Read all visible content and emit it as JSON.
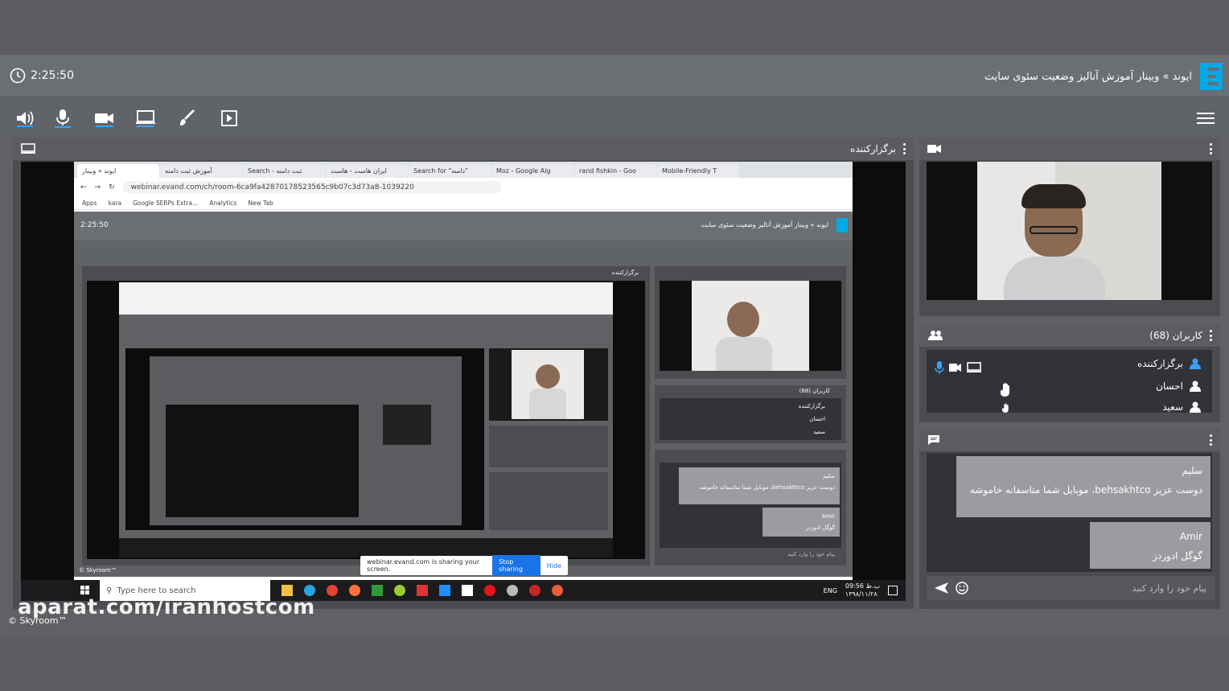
{
  "header": {
    "time": "2:25:50",
    "title": "ایوند » وبینار آموزش آنالیز وضعیت سئوی سایت"
  },
  "toolbar": {
    "icons": [
      "speaker-icon",
      "microphone-icon",
      "camera-icon",
      "screen-share-icon",
      "brush-icon",
      "play-file-icon"
    ]
  },
  "presenter_panel": {
    "title": "برگزارکننده"
  },
  "shared_screen": {
    "tabs": [
      "ایوند » وبینار",
      "آموزش ثبت دامنه",
      "Search - ثبت دامنه",
      "ایران هاست - هاست",
      "Search for \"دامنه\"",
      "Moz - Google Alg",
      "rand fishkin - Goo",
      "Mobile-Friendly T"
    ],
    "url": "webinar.evand.com/ch/room-6ca9fa42870178523565c9b07c3d73a8-1039220",
    "bookmarks": [
      "Apps",
      "kara",
      "Google SERPs Extra...",
      "Analytics",
      "New Tab"
    ],
    "inner_time": "2:25:50",
    "inner_title": "ایوند » وبینار آموزش آنالیز وضعیت سئوی سایت",
    "inner_presenter": "برگزارکننده",
    "inner_users_title": "کاربران (68)",
    "inner_users": [
      "برگزارکننده",
      "احسان",
      "سعید"
    ],
    "inner_chat": [
      {
        "name": "سلیم",
        "text": "دوست عزیز behsakhtco، موبایل شما متاسفانه خاموشه"
      },
      {
        "name": "Amir",
        "text": "گوگل ادوردز"
      }
    ],
    "inner_chat_placeholder": "پیام خود را وارد کنید",
    "share_notice": "webinar.evand.com is sharing your screen.",
    "stop_sharing": "Stop sharing",
    "hide": "Hide",
    "skyroom": "© Skyroom™",
    "taskbar_search": "Type here to search",
    "taskbar_lang": "ENG",
    "taskbar_time": "09:56 ب.ظ",
    "taskbar_date": "۱۳۹۸/۱۱/۲۸"
  },
  "users_panel": {
    "title": "کاربران (68)",
    "users": [
      "برگزارکننده",
      "احسان",
      "سعید"
    ]
  },
  "chat_panel": {
    "messages": [
      {
        "name": "سلیم",
        "text": "دوست عزیز behsakhtco، موبایل شما متاسفانه خاموشه"
      },
      {
        "name": "Amir",
        "text": "گوگل ادوردز"
      }
    ],
    "placeholder": "پیام خود را وارد کنید"
  },
  "watermark": "aparat.com/iranhostcom",
  "brand": "© Skyroom™"
}
